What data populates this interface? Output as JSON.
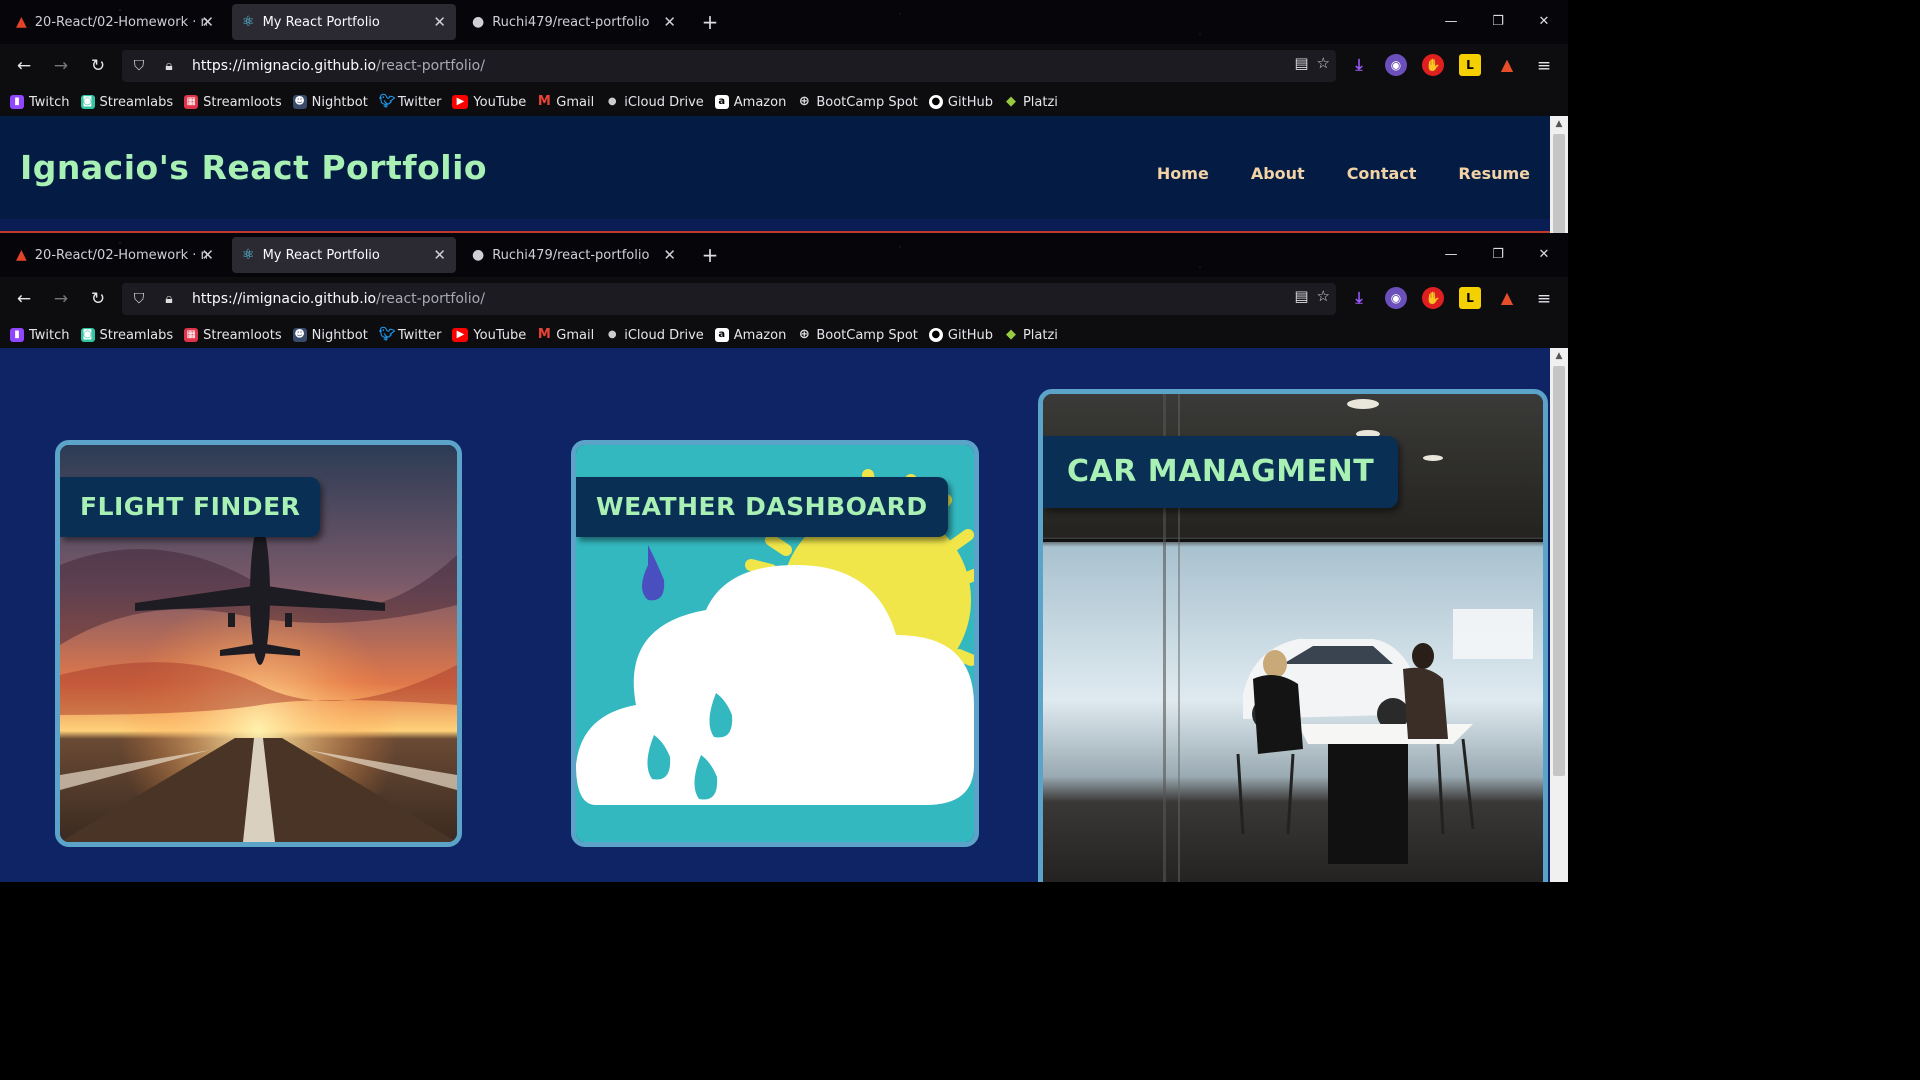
{
  "browser": {
    "tabs": [
      {
        "label": "20-React/02-Homework · maste",
        "icon": "gitlab-icon"
      },
      {
        "label": "My React Portfolio",
        "icon": "react-icon"
      },
      {
        "label": "Ruchi479/react-portfolio",
        "icon": "github-icon"
      }
    ],
    "url_host": "https://imignacio.github.io",
    "url_path": "/react-portfolio/",
    "bookmarks": [
      "Twitch",
      "Streamlabs",
      "Streamloots",
      "Nightbot",
      "Twitter",
      "YouTube",
      "Gmail",
      "iCloud Drive",
      "Amazon",
      "BootCamp Spot",
      "GitHub",
      "Platzi"
    ]
  },
  "site": {
    "title": "Ignacio's React Portfolio",
    "nav": [
      "Home",
      "About",
      "Contact",
      "Resume"
    ]
  },
  "projects": [
    {
      "label": "FLIGHT FINDER",
      "image": "airplane-sunset-runway"
    },
    {
      "label": "WEATHER DASHBOARD",
      "image": "sun-cloud-raindrops"
    },
    {
      "label": "CAR MANAGMENT",
      "image": "car-showroom-meeting"
    }
  ],
  "colors": {
    "header_bg": "#041b44",
    "title_green": "#a8f0b4",
    "nav_peach": "#f2d3a6",
    "page_bg": "#0e2465",
    "card_border": "#5ba3c9"
  }
}
